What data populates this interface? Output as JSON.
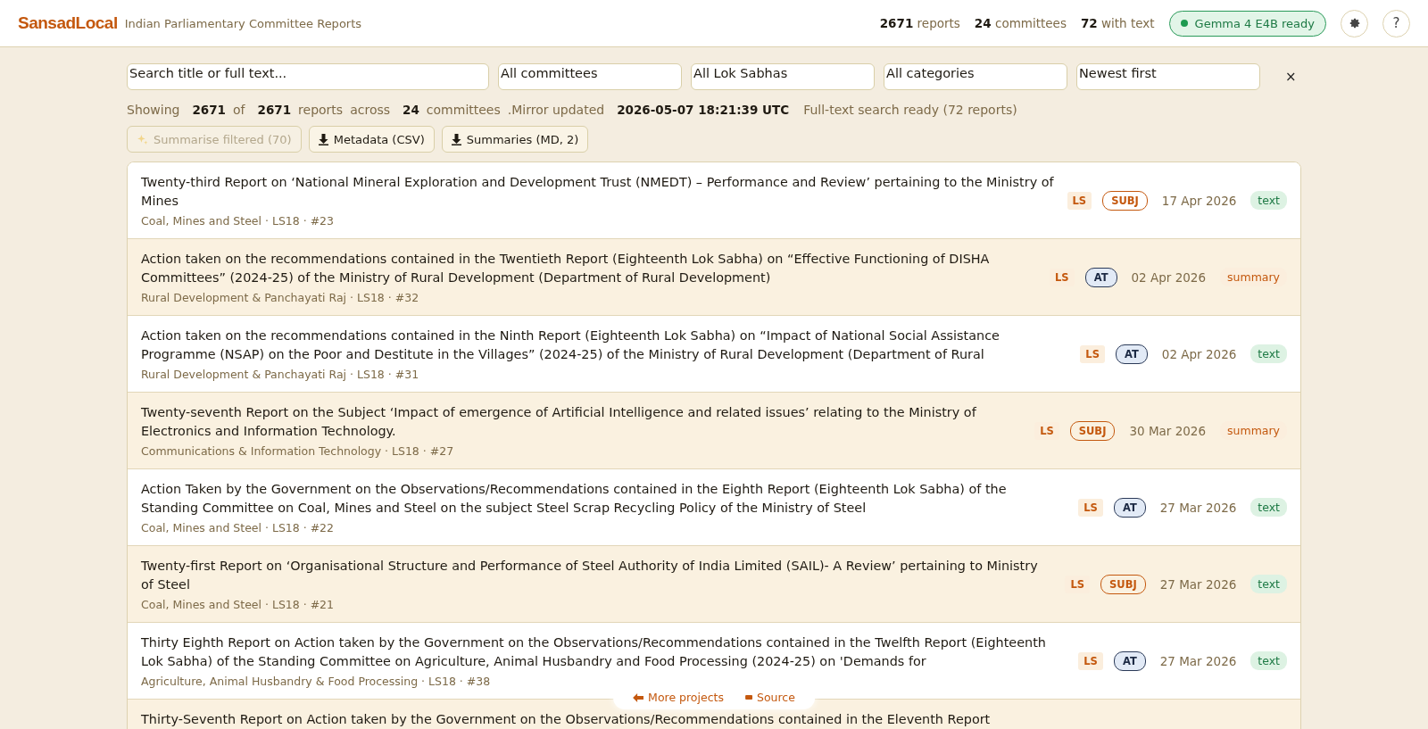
{
  "header": {
    "logo": "SansadLocal",
    "subtitle": "Indian Parliamentary Committee Reports",
    "stats": [
      {
        "count": "2671",
        "label": "reports"
      },
      {
        "count": "24",
        "label": "committees"
      },
      {
        "count": "72",
        "label": "with text"
      }
    ],
    "model_status": {
      "label": "Gemma 4 E4B ready",
      "ready": true
    },
    "help": "?"
  },
  "filters": {
    "search": {
      "placeholder": "Search title or full text..."
    },
    "selects": [
      {
        "value": "All committees"
      },
      {
        "value": "All Lok Sabhas"
      },
      {
        "value": "All categories"
      },
      {
        "value": "Newest first"
      }
    ],
    "clear": "×"
  },
  "summary_line": [
    {
      "text": "Showing",
      "bold": false
    },
    {
      "text": "2671",
      "bold": true
    },
    {
      "text": "of",
      "bold": false
    },
    {
      "text": "2671",
      "bold": true
    },
    {
      "text": "reports",
      "bold": false
    },
    {
      "text": "across",
      "bold": false
    },
    {
      "text": "24",
      "bold": true
    },
    {
      "text": "committees",
      "bold": false
    },
    {
      "text": ".Mirror updated",
      "bold": false
    },
    {
      "text": "2026-05-07 18:21:39 UTC",
      "bold": true
    },
    {
      "text": "Full-text search ready (72 reports)",
      "bold": false
    }
  ],
  "actions": [
    {
      "label": "Summarise filtered (70)",
      "kind": "sparkles",
      "disabled": true
    },
    {
      "label": "Metadata (CSV)",
      "kind": "download",
      "disabled": false
    },
    {
      "label": "Summaries (MD, 2)",
      "kind": "download",
      "disabled": false
    }
  ],
  "reports": [
    {
      "title": "Twenty-third Report on ‘National Mineral Exploration and Development Trust (NMEDT) – Performance and Review’ pertaining to the Ministry of Mines",
      "meta": "Coal, Mines and Steel · LS18 · #23",
      "house": "LS",
      "category": {
        "label": "SUBJ",
        "kind": "subject"
      },
      "date": "17 Apr 2026",
      "status": {
        "label": "text",
        "kind": "text"
      }
    },
    {
      "title": "Action taken on the recommendations contained in the Twentieth Report (Eighteenth Lok Sabha) on “Effective Functioning of DISHA Committees” (2024-25) of the Ministry of Rural Development (Department of Rural Development)",
      "meta": "Rural Development & Panchayati Raj · LS18 · #32",
      "house": "LS",
      "category": {
        "label": "AT",
        "kind": "action"
      },
      "date": "02 Apr 2026",
      "status": {
        "label": "summary",
        "kind": "summary"
      }
    },
    {
      "title": "Action taken on the recommendations contained in the Ninth Report (Eighteenth Lok Sabha) on “Impact of National Social Assistance Programme (NSAP) on the Poor and Destitute in the Villages” (2024-25) of the Ministry of Rural Development (Department of Rural",
      "meta": "Rural Development & Panchayati Raj · LS18 · #31",
      "house": "LS",
      "category": {
        "label": "AT",
        "kind": "action"
      },
      "date": "02 Apr 2026",
      "status": {
        "label": "text",
        "kind": "text"
      }
    },
    {
      "title": "Twenty-seventh Report on the Subject ‘Impact of emergence of Artificial Intelligence and related issues’ relating to the Ministry of Electronics and Information Technology.",
      "meta": "Communications & Information Technology · LS18 · #27",
      "house": "LS",
      "category": {
        "label": "SUBJ",
        "kind": "subject"
      },
      "date": "30 Mar 2026",
      "status": {
        "label": "summary",
        "kind": "summary"
      }
    },
    {
      "title": "Action Taken by the Government on the Observations/Recommendations contained in the Eighth Report (Eighteenth Lok Sabha) of the Standing Committee on Coal, Mines and Steel on the subject Steel Scrap Recycling Policy of the Ministry of Steel",
      "meta": "Coal, Mines and Steel · LS18 · #22",
      "house": "LS",
      "category": {
        "label": "AT",
        "kind": "action"
      },
      "date": "27 Mar 2026",
      "status": {
        "label": "text",
        "kind": "text"
      }
    },
    {
      "title": "Twenty-first Report on ‘Organisational Structure and Performance of Steel Authority of India Limited (SAIL)- A Review’ pertaining to Ministry of Steel",
      "meta": "Coal, Mines and Steel · LS18 · #21",
      "house": "LS",
      "category": {
        "label": "SUBJ",
        "kind": "subject"
      },
      "date": "27 Mar 2026",
      "status": {
        "label": "text",
        "kind": "text"
      }
    },
    {
      "title": "Thirty Eighth Report on Action taken by the Government on the Observations/Recommendations contained in the Twelfth Report (Eighteenth Lok Sabha) of the Standing Committee on Agriculture, Animal Husbandry and Food Processing (2024-25) on 'Demands for",
      "meta": "Agriculture, Animal Husbandry & Food Processing · LS18 · #38",
      "house": "LS",
      "category": {
        "label": "AT",
        "kind": "action"
      },
      "date": "27 Mar 2026",
      "status": {
        "label": "text",
        "kind": "text"
      }
    },
    {
      "title": "Thirty-Seventh Report on Action taken by the Government on the Observations/Recommendations contained in the Eleventh Report",
      "kind": "partial"
    }
  ],
  "footer_links": [
    {
      "label": "More projects",
      "kind": "back"
    },
    {
      "label": "Source",
      "kind": "source"
    }
  ]
}
